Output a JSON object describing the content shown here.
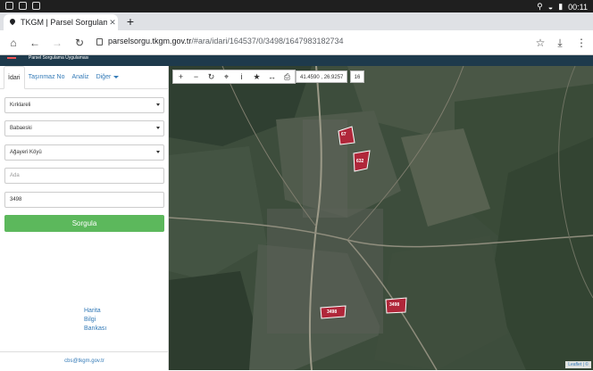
{
  "statusbar": {
    "time": "00:11"
  },
  "browser": {
    "tab_title": "TKGM | Parsel Sorgulama U",
    "url_host": "parselsorgu.tkgm.gov.tr",
    "url_path": "/#ara/idari/164537/0/3498/1647983182734"
  },
  "app": {
    "header_title": "Parsel Sorgulama Uygulaması"
  },
  "sidebar": {
    "tabs": [
      {
        "label": "İdari"
      },
      {
        "label": "Taşınmaz No"
      },
      {
        "label": "Analiz"
      },
      {
        "label": "Diğer"
      }
    ],
    "fields": {
      "il": "Kırklareli",
      "ilce": "Babaeski",
      "mahalle": "Ağayeri Köyü",
      "ada_placeholder": "Ada",
      "parsel": "3498"
    },
    "search_button": "Sorgula",
    "links": [
      "Harita",
      "Bilgi",
      "Bankası"
    ],
    "footer_email": "cbs@tkgm.gov.tr"
  },
  "map": {
    "coordinates": "41.4590 , 26.9257",
    "zoom": "16",
    "attribution": "Leaflet | ©",
    "parcels": [
      {
        "label": "67"
      },
      {
        "label": "632"
      },
      {
        "label": "3498"
      },
      {
        "label": "3498"
      }
    ],
    "colors": {
      "parcel_fill": "#b0273a",
      "parcel_stroke": "#ffffff"
    }
  }
}
